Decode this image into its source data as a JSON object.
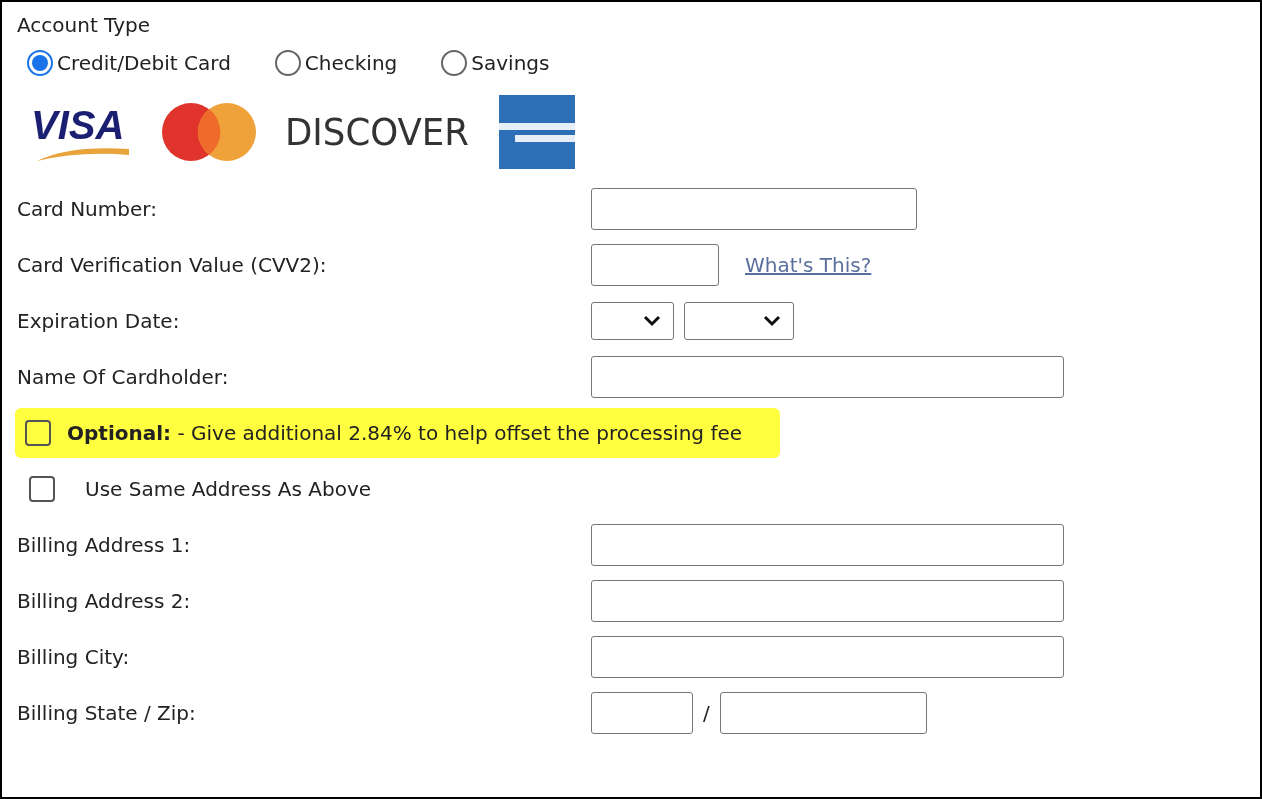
{
  "account_type": {
    "label": "Account Type",
    "options": [
      {
        "label": "Credit/Debit Card",
        "selected": true
      },
      {
        "label": "Checking",
        "selected": false
      },
      {
        "label": "Savings",
        "selected": false
      }
    ]
  },
  "card_logos": [
    {
      "kind": "visa",
      "text": "VISA"
    },
    {
      "kind": "mastercard"
    },
    {
      "kind": "discover",
      "text": "DISCOVER"
    },
    {
      "kind": "amex"
    }
  ],
  "card_fields": [
    {
      "kind": "text",
      "label": "Card Number:"
    },
    {
      "kind": "cvv",
      "label": "Card Verification Value (CVV2):",
      "link": "What's This?"
    },
    {
      "kind": "expiry",
      "label": "Expiration Date:"
    },
    {
      "kind": "wide_text",
      "label": "Name Of Cardholder:"
    }
  ],
  "checkboxes": [
    {
      "text": "**Optional:** - Give additional 2.84% to help offset the processing fee",
      "checked": false,
      "highlighted": true
    },
    {
      "text": "Use Same Address As Above",
      "checked": false,
      "highlighted": false
    }
  ],
  "billing_fields": [
    {
      "kind": "wide_text",
      "label": "Billing Address 1:"
    },
    {
      "kind": "wide_text",
      "label": "Billing Address 2:"
    },
    {
      "kind": "wide_text",
      "label": "Billing City:"
    },
    {
      "kind": "state_zip",
      "label": "Billing State / Zip:",
      "separator": "/"
    }
  ]
}
